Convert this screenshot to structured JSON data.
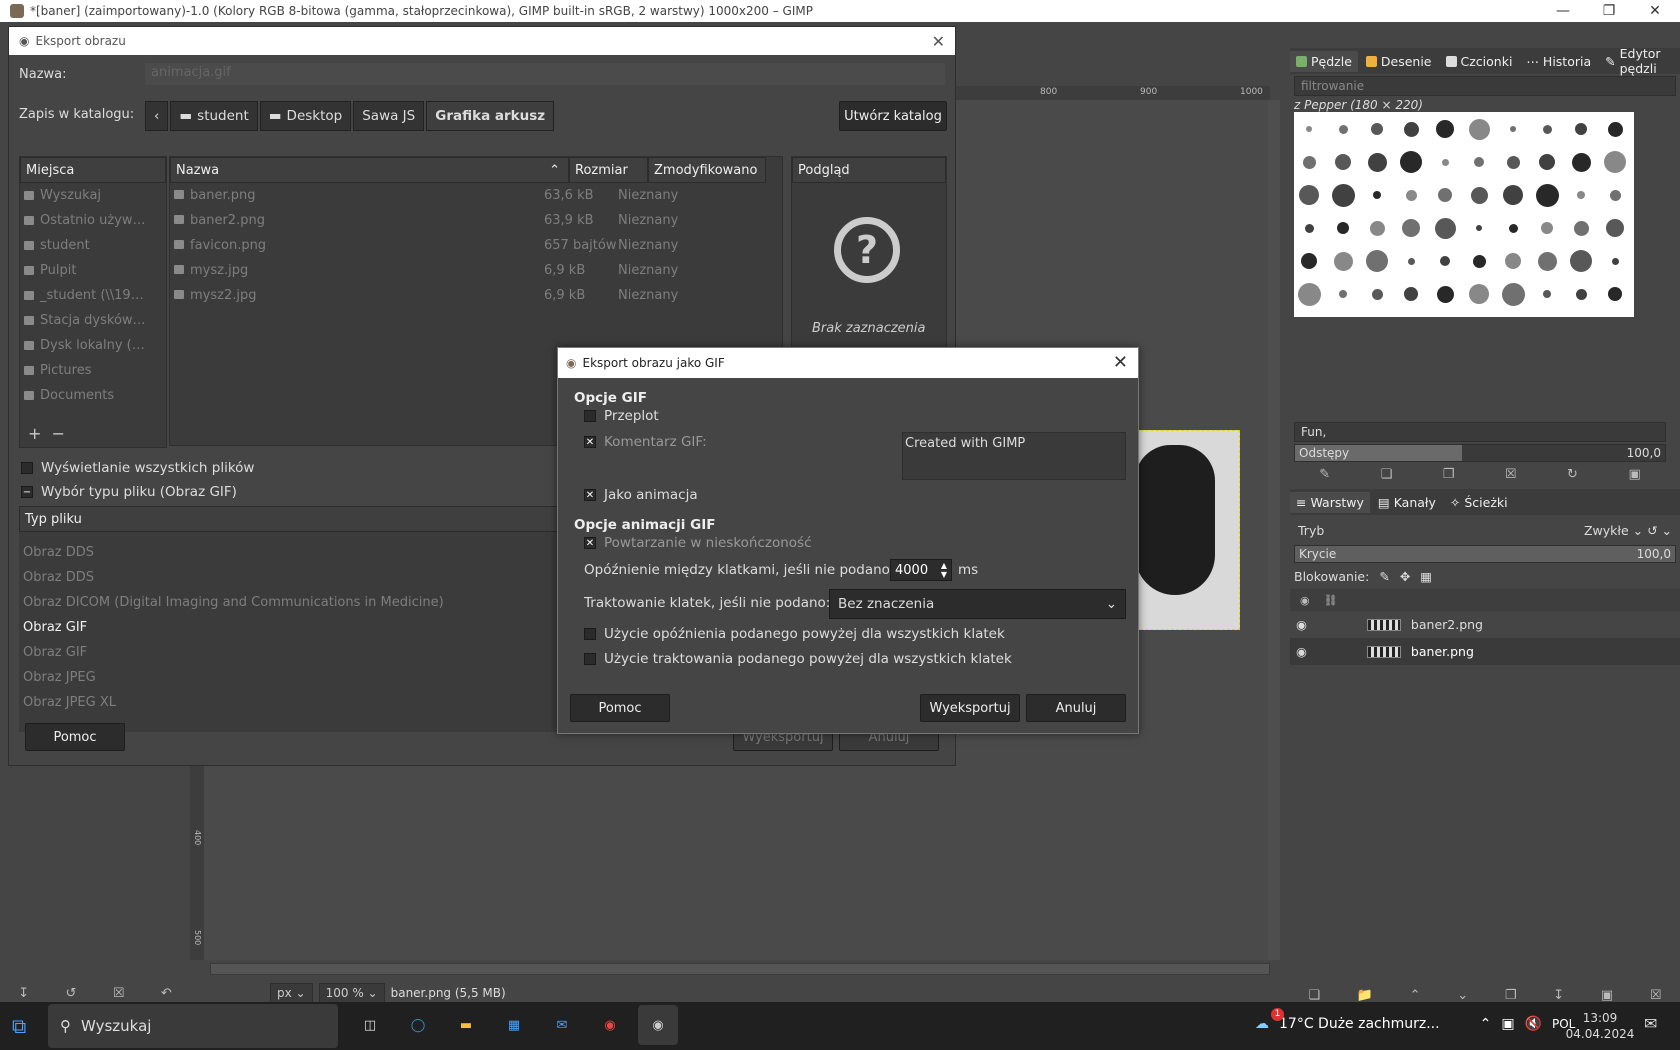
{
  "window": {
    "title": "*[baner] (zaimportowany)-1.0 (Kolory RGB 8-bitowa (gamma, stałoprzecinkowa), GIMP built-in sRGB, 2 warstwy) 1000x200 – GIMP"
  },
  "ruler": {
    "ticks": [
      "800",
      "900",
      "1000"
    ],
    "v_ticks": [
      "400",
      "500"
    ]
  },
  "status": {
    "unit": "px",
    "zoom": "100 %",
    "file": "baner.png (5,5 MB)"
  },
  "brushes": {
    "tabs": [
      "Pędzle",
      "Desenie",
      "Czcionki",
      "Historia",
      "Edytor pędzli"
    ],
    "filter_placeholder": "filtrowanie",
    "current": "z Pepper (180 × 220)",
    "tag": "Fun,",
    "spacing_label": "Odstępy",
    "spacing_value": "100,0",
    "spacing_pct": 1.0
  },
  "layers": {
    "tabs": [
      "Warstwy",
      "Kanały",
      "Ścieżki"
    ],
    "mode_label": "Tryb",
    "mode_value": "Zwykłe",
    "opacity_label": "Krycie",
    "opacity_value": "100,0",
    "lock_label": "Blokowanie:",
    "items": [
      {
        "name": "baner2.png"
      },
      {
        "name": "baner.png"
      }
    ]
  },
  "export": {
    "title": "Eksport obrazu",
    "name_label": "Nazwa:",
    "name_value": "animacja.gif",
    "folder_label": "Zapis w katalogu:",
    "crumbs": [
      "student",
      "Desktop",
      "Sawa JS",
      "Grafika arkusz"
    ],
    "create_folder": "Utwórz katalog",
    "places_header": "Miejsca",
    "places": [
      "Wyszukaj",
      "Ostatnio używ…",
      "student",
      "Pulpit",
      "_student (\\\\19…",
      "Stacja dysków…",
      "Dysk lokalny (…",
      "Pictures",
      "Documents"
    ],
    "columns": {
      "name": "Nazwa",
      "size": "Rozmiar",
      "modified": "Zmodyfikowano"
    },
    "files": [
      {
        "name": "baner.png",
        "size": "63,6 kB",
        "modified": "Nieznany"
      },
      {
        "name": "baner2.png",
        "size": "63,9 kB",
        "modified": "Nieznany"
      },
      {
        "name": "favicon.png",
        "size": "657 bajtów",
        "modified": "Nieznany"
      },
      {
        "name": "mysz.jpg",
        "size": "6,9 kB",
        "modified": "Nieznany"
      },
      {
        "name": "mysz2.jpg",
        "size": "6,9 kB",
        "modified": "Nieznany"
      }
    ],
    "preview_header": "Podgląd",
    "preview_empty": "Brak zaznaczenia",
    "show_all": "Wyświetlanie wszystkich plików",
    "file_type_toggle": "Wybór typu pliku (Obraz GIF)",
    "file_type_header": "Typ pliku",
    "file_types": [
      "Obraz DDS",
      "Obraz DDS",
      "Obraz DICOM (Digital Imaging and Communications in Medicine)",
      "Obraz GIF",
      "Obraz GIF",
      "Obraz JPEG",
      "Obraz JPEG XL"
    ],
    "selected_type_index": 3,
    "help": "Pomoc",
    "export_btn": "Wyeksportuj",
    "cancel_btn": "Anuluj"
  },
  "gif": {
    "title": "Eksport obrazu jako GIF",
    "section1": "Opcje GIF",
    "interlace": "Przeplot",
    "comment_label": "Komentarz GIF:",
    "comment_value": "Created with GIMP",
    "as_animation": "Jako animacja",
    "section2": "Opcje animacji GIF",
    "loop": "Powtarzanie w nieskończoność",
    "delay_label": "Opóźnienie między klatkami, jeśli nie podano:",
    "delay_value": "4000",
    "delay_unit": "ms",
    "disposal_label": "Traktowanie klatek, jeśli nie podano:",
    "disposal_value": "Bez znaczenia",
    "use_delay_all": "Użycie opóźnienia podanego powyżej dla wszystkich klatek",
    "use_disposal_all": "Użycie traktowania podanego powyżej dla wszystkich klatek",
    "help": "Pomoc",
    "export_btn": "Wyeksportuj",
    "cancel_btn": "Anuluj"
  },
  "taskbar": {
    "search": "Wyszukaj",
    "weather": "17°C  Duże zachmurz...",
    "lang": "POL",
    "time": "13:09",
    "date": "04.04.2024",
    "badge": "1"
  }
}
